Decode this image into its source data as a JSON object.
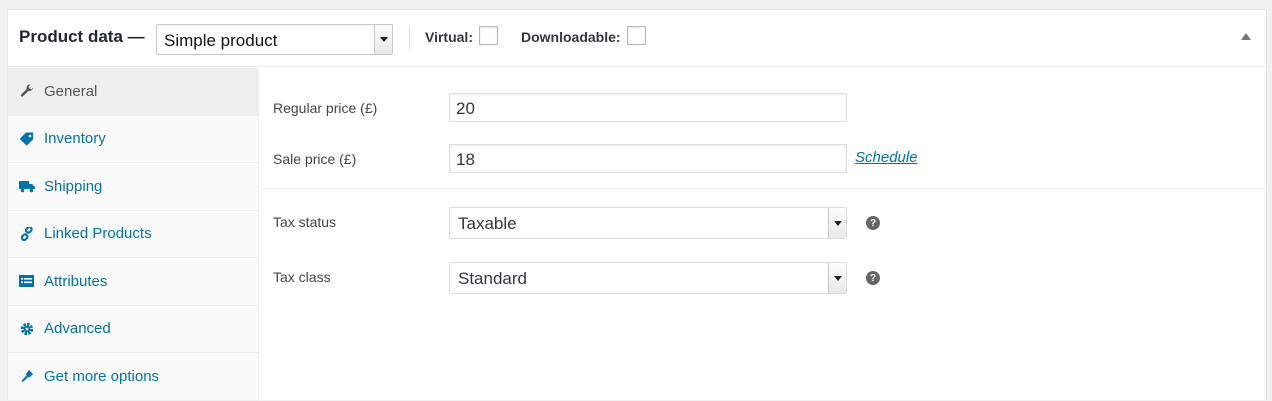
{
  "header": {
    "title": "Product data —",
    "product_type": "Simple product",
    "virtual_label": "Virtual:",
    "downloadable_label": "Downloadable:",
    "virtual_checked": false,
    "downloadable_checked": false
  },
  "tabs": [
    {
      "label": "General",
      "icon": "wrench-icon",
      "active": true
    },
    {
      "label": "Inventory",
      "icon": "tag-icon",
      "active": false
    },
    {
      "label": "Shipping",
      "icon": "truck-icon",
      "active": false
    },
    {
      "label": "Linked Products",
      "icon": "link-icon",
      "active": false
    },
    {
      "label": "Attributes",
      "icon": "list-icon",
      "active": false
    },
    {
      "label": "Advanced",
      "icon": "gear-icon",
      "active": false
    },
    {
      "label": "Get more options",
      "icon": "plug-icon",
      "active": false
    }
  ],
  "general": {
    "regular_price_label": "Regular price (£)",
    "regular_price": "20",
    "sale_price_label": "Sale price (£)",
    "sale_price": "18",
    "schedule_link": "Schedule",
    "tax_status_label": "Tax status",
    "tax_status": "Taxable",
    "tax_class_label": "Tax class",
    "tax_class": "Standard",
    "help_glyph": "?"
  },
  "colors": {
    "link": "#0073aa",
    "active_tab_bg": "#eeeeee"
  }
}
